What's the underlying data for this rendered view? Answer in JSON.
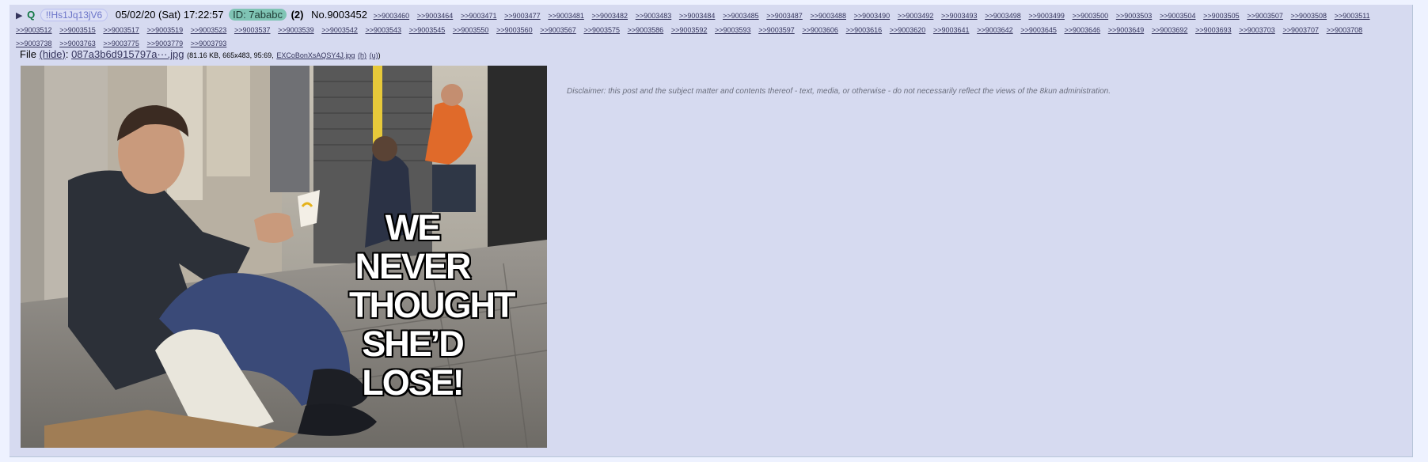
{
  "post": {
    "arrow": "▶",
    "name": "Q",
    "tripcode": "!!Hs1Jq13jV6",
    "date": "05/02/20 (Sat) 17:22:57",
    "id_label": "ID: 7ababc",
    "id_color": "#7fc4b4",
    "reply_count": "(2)",
    "post_number": "No.9003452",
    "backlinks": [
      ">>9003460",
      ">>9003464",
      ">>9003471",
      ">>9003477",
      ">>9003481",
      ">>9003482",
      ">>9003483",
      ">>9003484",
      ">>9003485",
      ">>9003487",
      ">>9003488",
      ">>9003490",
      ">>9003492",
      ">>9003493",
      ">>9003498",
      ">>9003499",
      ">>9003500",
      ">>9003503",
      ">>9003504",
      ">>9003505",
      ">>9003507",
      ">>9003508",
      ">>9003511",
      ">>9003512",
      ">>9003515",
      ">>9003517",
      ">>9003519",
      ">>9003523",
      ">>9003537",
      ">>9003539",
      ">>9003542",
      ">>9003543",
      ">>9003545",
      ">>9003550",
      ">>9003560",
      ">>9003567",
      ">>9003575",
      ">>9003586",
      ">>9003592",
      ">>9003593",
      ">>9003597",
      ">>9003606",
      ">>9003616",
      ">>9003620",
      ">>9003641",
      ">>9003642",
      ">>9003645",
      ">>9003646",
      ">>9003649",
      ">>9003692",
      ">>9003693",
      ">>9003703",
      ">>9003707",
      ">>9003708",
      ">>9003738",
      ">>9003763",
      ">>9003775",
      ">>9003779",
      ">>9003793"
    ]
  },
  "file": {
    "label": "File",
    "hide_label": "(hide)",
    "filename": "087a3b6d915797a···.jpg",
    "meta_prefix": "(81.16 KB, 665x483, 95:69,",
    "original_name": "EXCoBonXsAQSY4J.jpg",
    "link_h": "(h)",
    "link_u": "(u)",
    "meta_suffix": ")"
  },
  "image": {
    "caption_lines": [
      "WE",
      "NEVER",
      "THOUGHT",
      "SHE’D LOSE!"
    ]
  },
  "disclaimer": "Disclaimer: this post and the subject matter and contents thereof - text, media, or otherwise - do not necessarily reflect the views of the 8kun administration."
}
